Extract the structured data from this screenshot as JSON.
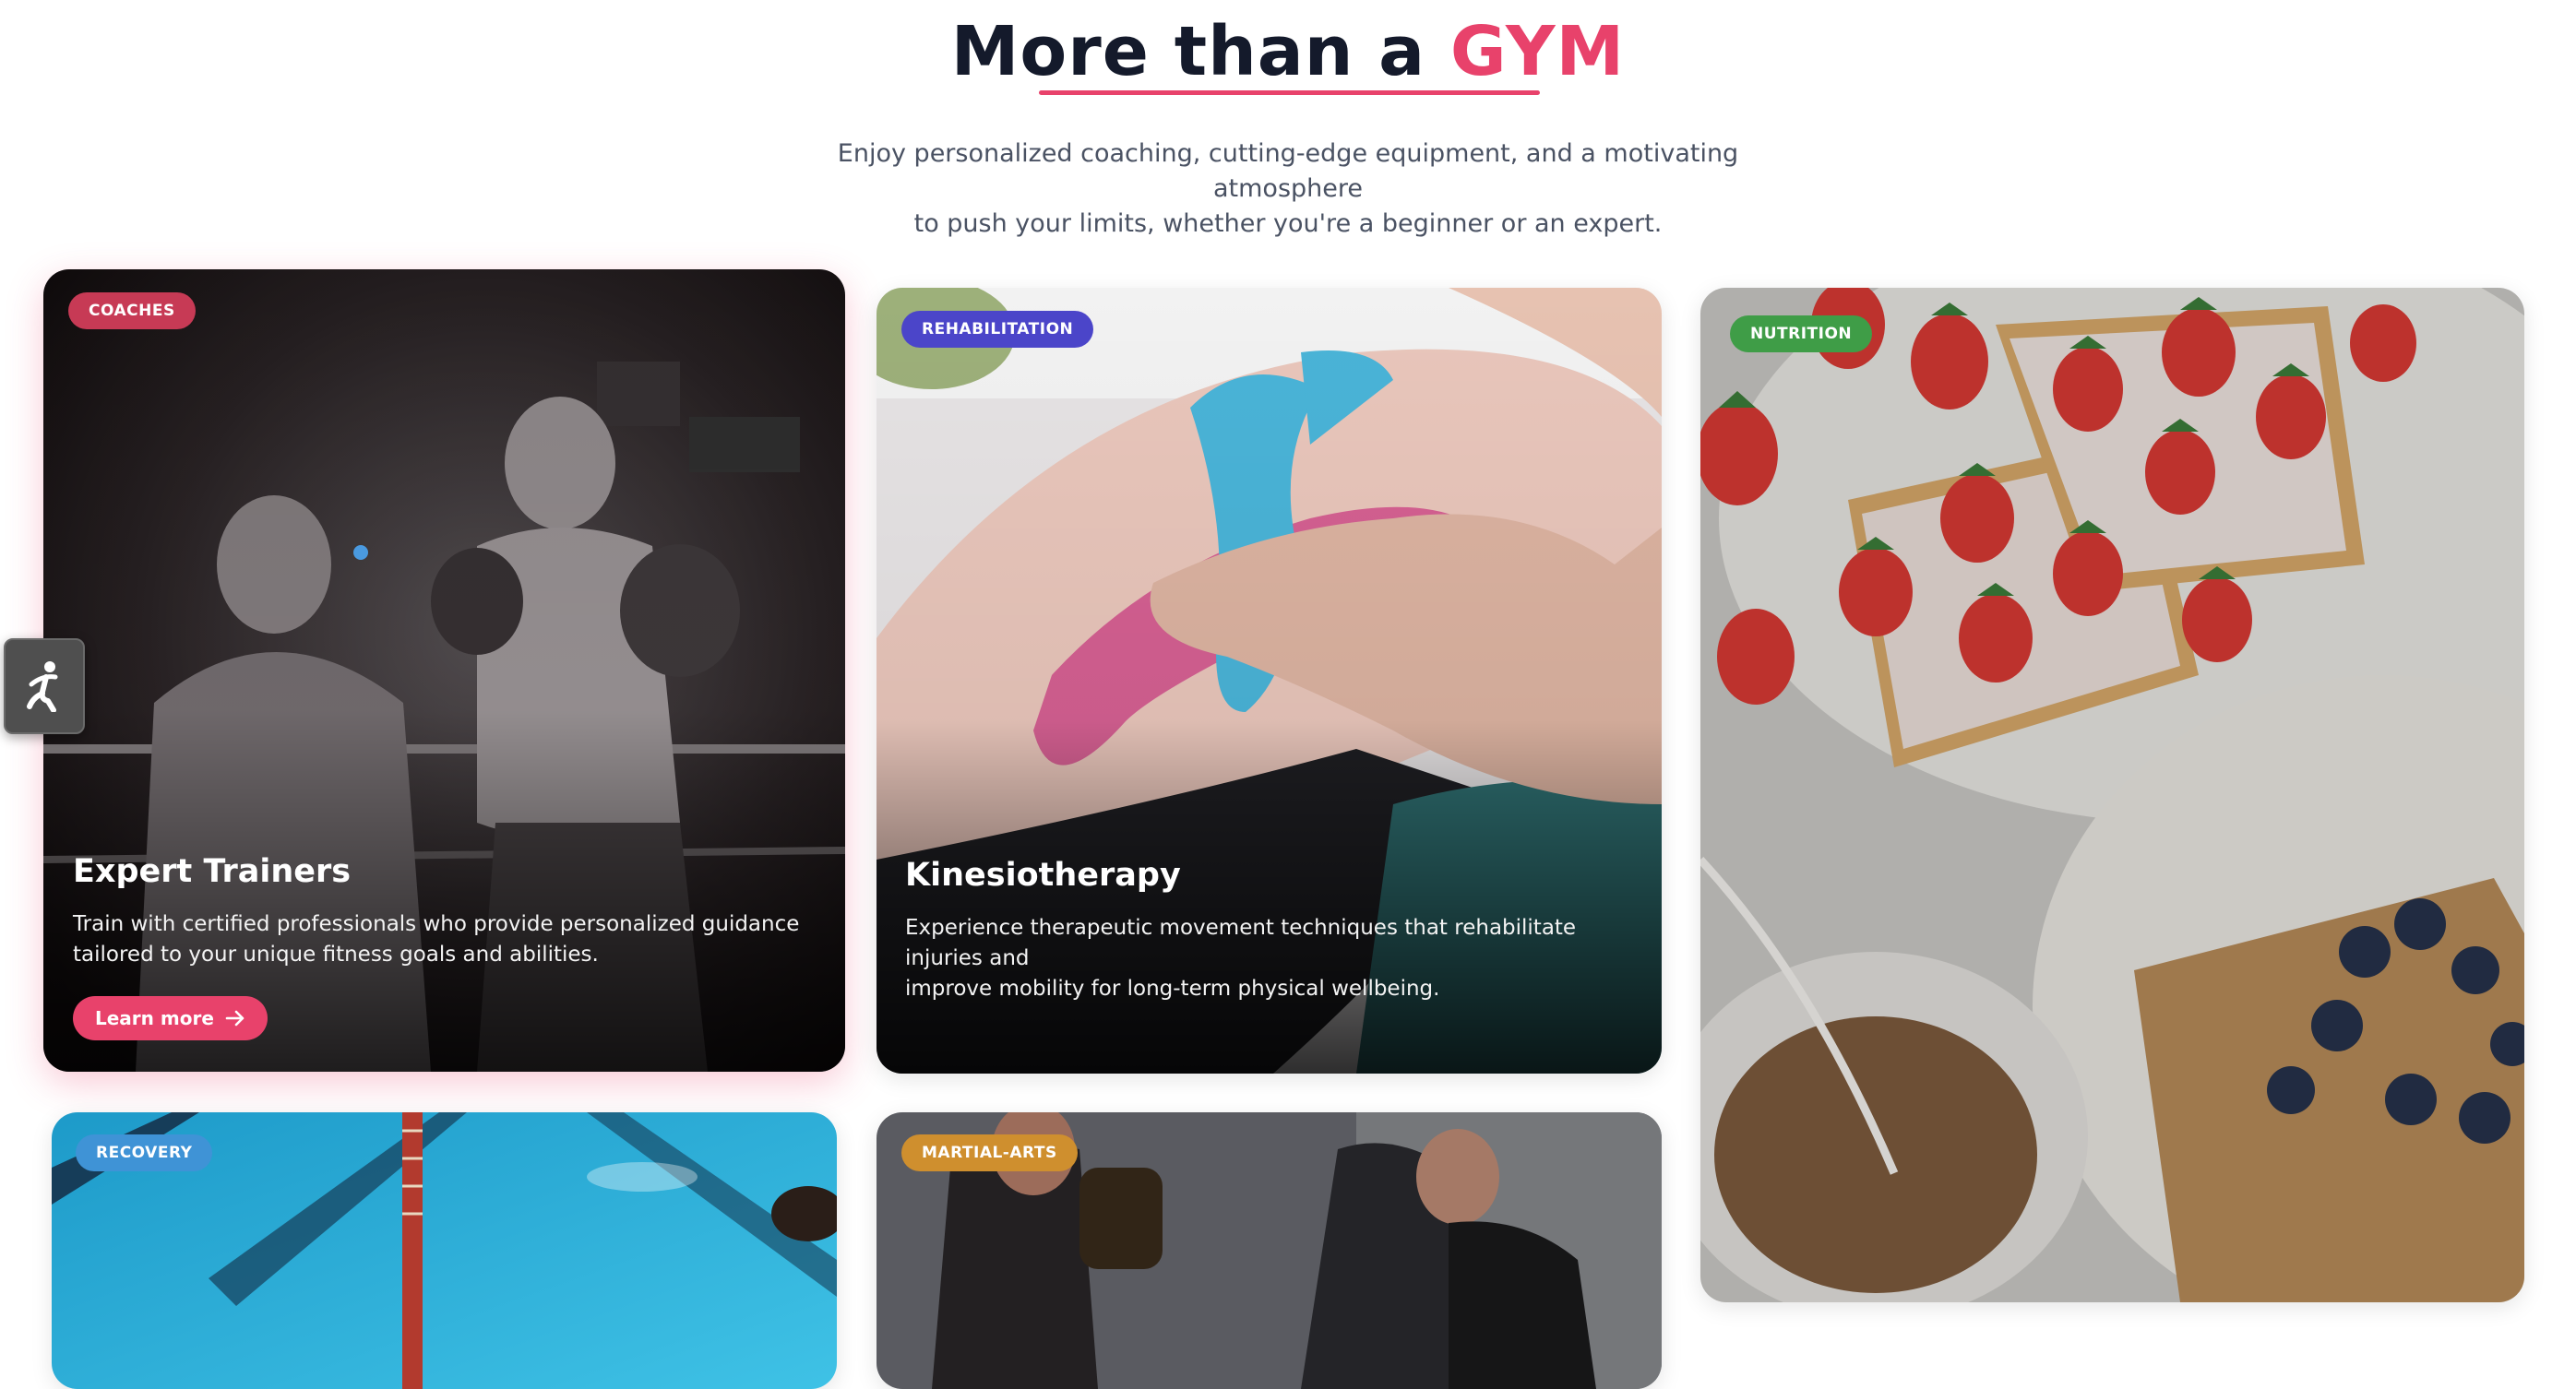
{
  "hero": {
    "title_main": "More than a ",
    "title_accent": "GYM",
    "subtitle_line1": "Enjoy personalized coaching, cutting-edge equipment, and a motivating atmosphere",
    "subtitle_line2": "to push your limits, whether you're a beginner or an expert."
  },
  "cards": {
    "coaches": {
      "badge": "COACHES",
      "title": "Expert Trainers",
      "desc_line1": "Train with certified professionals who provide personalized guidance",
      "desc_line2": "tailored to your unique fitness goals and abilities.",
      "button": "Learn more",
      "image": "boxing-trainer-photo",
      "badge_color": "#c73a55"
    },
    "rehabilitation": {
      "badge": "REHABILITATION",
      "title": "Kinesiotherapy",
      "desc_line1": "Experience therapeutic movement techniques that rehabilitate injuries and",
      "desc_line2": "improve mobility for long-term physical wellbeing.",
      "image": "kinesio-tape-knee-photo",
      "badge_color": "#4b45c9"
    },
    "nutrition": {
      "badge": "NUTRITION",
      "image": "strawberry-toast-breakfast-photo",
      "badge_color": "#3f9d47"
    },
    "recovery": {
      "badge": "RECOVERY",
      "image": "swimming-pool-lanes-photo",
      "badge_color": "#3f93d6"
    },
    "martial_arts": {
      "badge": "MARTIAL-ARTS",
      "image": "martial-arts-sparring-photo",
      "badge_color": "#cf8f2e"
    }
  },
  "accent_color": "#e8426b",
  "icons": {
    "side_widget": "accessibility-person-icon",
    "learn_more": "arrow-right-icon"
  }
}
